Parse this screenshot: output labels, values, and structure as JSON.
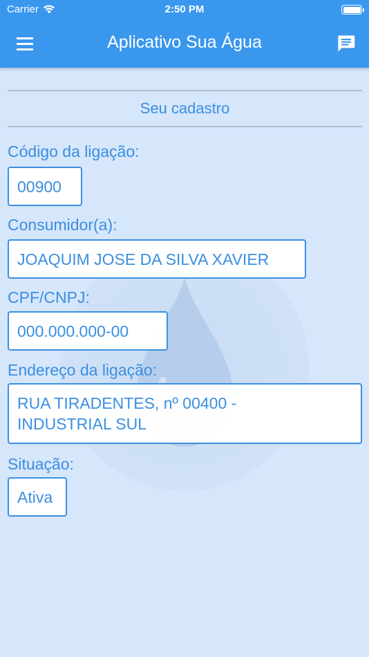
{
  "status_bar": {
    "carrier": "Carrier",
    "time": "2:50 PM"
  },
  "app_bar": {
    "title": "Aplicativo Sua Água",
    "menu_icon": "menu-icon",
    "chat_icon": "chat-icon"
  },
  "section": {
    "title": "Seu cadastro"
  },
  "fields": [
    {
      "label": "Código da ligação:",
      "value": "00900"
    },
    {
      "label": "Consumidor(a):",
      "value": "JOAQUIM JOSE DA SILVA XAVIER"
    },
    {
      "label": "CPF/CNPJ:",
      "value": "000.000.000-00"
    },
    {
      "label": "Endereço da ligação:",
      "value": "RUA TIRADENTES, nº 00400 - INDUSTRIAL SUL"
    },
    {
      "label": "Situação:",
      "value": "Ativa"
    }
  ],
  "colors": {
    "primary": "#3a97ee",
    "accent_text": "#3a8fe0",
    "background": "#d6e6fb"
  }
}
